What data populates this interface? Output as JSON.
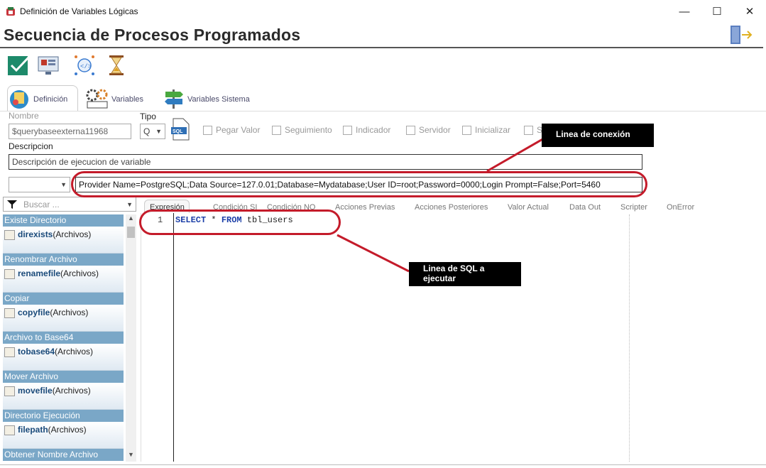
{
  "window": {
    "title": "Definición de Variables Lógicas",
    "minimize": "—",
    "maximize": "☐",
    "close": "✕"
  },
  "header": {
    "title": "Secuencia de Procesos Programados"
  },
  "toolbar": {
    "icons": [
      "check-icon",
      "preview-icon",
      "code-icon",
      "hourglass-icon"
    ]
  },
  "tabs": [
    {
      "label": "Definición",
      "icon": "definition-icon"
    },
    {
      "label": "Variables",
      "icon": "variables-icon"
    },
    {
      "label": "Variables Sistema",
      "icon": "signpost-icon"
    }
  ],
  "form": {
    "name_label": "Nombre",
    "name_value": "$querybaseexterna11968",
    "type_label": "Tipo",
    "type_value": "Q",
    "type_icon": "sql-icon",
    "checkboxes": [
      "Pegar Valor",
      "Seguimiento",
      "Indicador",
      "Servidor",
      "Inicializar",
      "S"
    ],
    "description_label": "Descripcion",
    "description_value": "Descripción de ejecucion de variable",
    "connection_value": "Provider Name=PostgreSQL;Data Source=127.0.01;Database=Mydatabase;User ID=root;Password=0000;Login Prompt=False;Port=5460"
  },
  "search": {
    "placeholder": "Buscar ..."
  },
  "editor_tabs": [
    "Expresión",
    "Condición SI",
    "Condición NO",
    "Acciones Previas",
    "Acciones Posteriores",
    "Valor Actual",
    "Data Out",
    "Scripter",
    "OnError"
  ],
  "sidebar": {
    "groups": [
      {
        "header": "Existe Directorio",
        "fn": "direxists",
        "args": "(Archivos)"
      },
      {
        "header": "Renombrar Archivo",
        "fn": "renamefile",
        "args": "(Archivos)"
      },
      {
        "header": "Copiar",
        "fn": "copyfile",
        "args": "(Archivos)"
      },
      {
        "header": "Archivo to Base64",
        "fn": "tobase64",
        "args": "(Archivos)"
      },
      {
        "header": "Mover Archivo",
        "fn": "movefile",
        "args": "(Archivos)"
      },
      {
        "header": "Directorio Ejecución",
        "fn": "filepath",
        "args": "(Archivos)"
      },
      {
        "header": "Obtener Nombre Archivo",
        "fn": "",
        "args": ""
      }
    ]
  },
  "editor": {
    "line_number": "1",
    "kw1": "SELECT",
    "star": " * ",
    "kw2": "FROM",
    "table": " tbl_users"
  },
  "callouts": {
    "connection": "Linea de conexión",
    "sql_line1": "Linea de SQL  a",
    "sql_line2": "ejecutar"
  },
  "colors": {
    "accent": "#c41b2a",
    "group_header": "#7aa7c7"
  }
}
